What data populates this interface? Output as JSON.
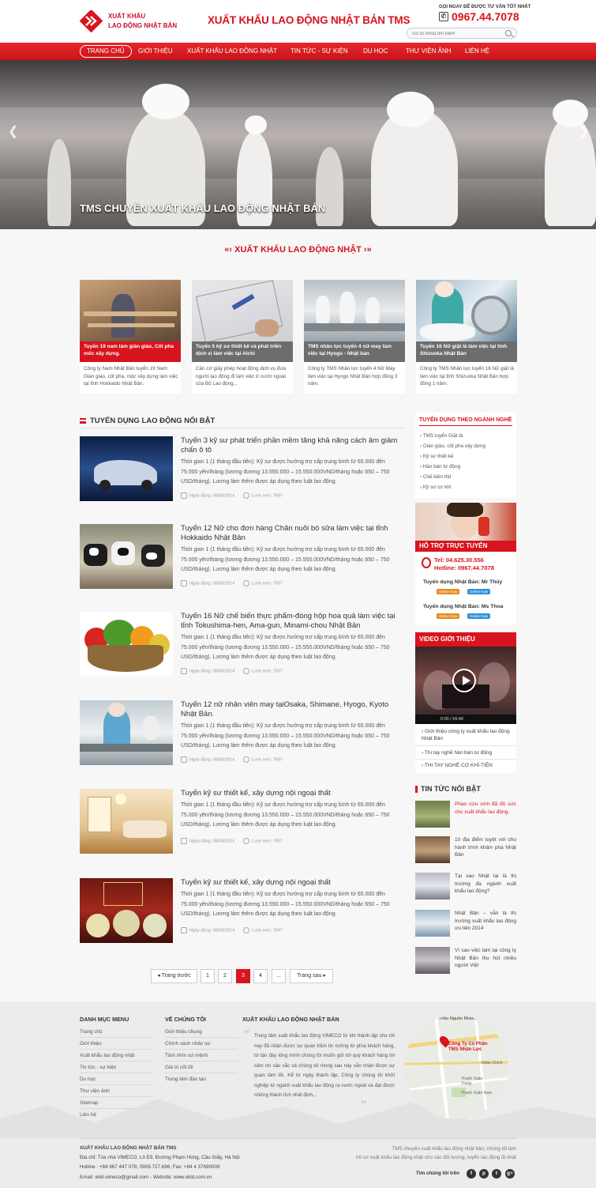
{
  "header": {
    "logo_line1": "XUẤT KHẨU",
    "logo_line2": "LAO ĐỘNG NHẬT BẢN",
    "site_title": "XUẤT KHẨU LAO ĐỘNG NHẬT BẢN TMS",
    "hotline_label": "GỌI NGAY ĐỂ ĐƯỢC TƯ VẤN TỐT NHẤT",
    "hotline_number": "0967.44.7078",
    "search_placeholder": "Gõ từ khóa tìm kiếm"
  },
  "nav": {
    "items": [
      "TRANG CHỦ",
      "GIỚI THIỆU",
      "XUẤT KHẨU LAO ĐỘNG NHẬT",
      "TIN TỨC - SỰ KIỆN",
      "DU HỌC",
      "THƯ VIỆN ẢNH",
      "LIÊN HỆ"
    ]
  },
  "banner": {
    "caption": "TMS CHUYÊN XUẤT KHẨU LAO ĐỘNG NHẬT BẢN",
    "prev": "❮",
    "next": "❯"
  },
  "featured": {
    "title": "XUẤT KHẨU LAO ĐỘNG NHẬT",
    "cards": [
      {
        "caption": "Tuyển 19 nam làm giàn giáo, Cốt pha mốc xây dựng.",
        "desc": "Công ty Nam Nhật Bản tuyển 19 Nam: Giàn giáo, cốt pha, mộc xây dựng làm việc tại tỉnh Hokkaido Nhật Bản."
      },
      {
        "caption": "Tuyển 5 kỹ sư thiết kế và phát triển dịch vị làm việc tại Aichi",
        "desc": "Căn cứ giấy phép hoạt động dịch vụ đưa người lao động đi làm việc ở nước ngoài của Bộ Lao động..."
      },
      {
        "caption": "TMS nhân lực tuyển 4 nữ may làm việc tại Hyogo - Nhật bản",
        "desc": "Công ty TMS Nhân lực tuyển 4 Nữ May làm việc tại Hyogo Nhật Bản hợp đồng 3 năm."
      },
      {
        "caption": "Tuyển 16 Nữ giặt là làm việc tại tỉnh Shizuoka Nhật Bản",
        "desc": "Công ty TMS Nhân lực tuyển 16 Nữ giặt là làm việc tại tỉnh Shizuoka Nhật Bản hợp đồng 1 năm."
      }
    ]
  },
  "jobs": {
    "title": "TUYỂN DỤNG LAO ĐỘNG NỔI BẬT",
    "items": [
      {
        "title": "Tuyển 3 kỹ sư phát triển phần mềm tăng khả năng cách âm giảm chấn ô tô",
        "desc": "Thời gian 1 (1 tháng đầu tiên): Kỹ sư được hưởng trợ cấp trung bình từ 65.000 đến 75.000 yên/tháng (tương đương 13.550.000 – 15.550.000VND/tháng hoặc 650 – 750 USD/tháng). Lương làm thêm được áp dụng theo luật lao động.",
        "date": "Ngày đăng: 08/08/2014",
        "views": "Lượt xem: 7897"
      },
      {
        "title": "Tuyển 12 Nữ cho đơn hàng Chăn nuôi bò sữa làm việc tại tỉnh Hokkaido Nhật Bản",
        "desc": "Thời gian 1 (1 tháng đầu tiên): Kỹ sư được hưởng trợ cấp trung bình từ 65.000 đến 75.000 yên/tháng (tương đương 13.550.000 – 15.550.000VND/tháng hoặc 650 – 750 USD/tháng). Lương làm thêm được áp dụng theo luật lao động.",
        "date": "Ngày đăng: 08/08/2014",
        "views": "Lượt xem: 7897"
      },
      {
        "title": "Tuyển 16 Nữ chế biến thực phẩm-đóng hộp hoa quả làm việc tại tỉnh Tokushima-hen, Ama-gun, Minami-chou Nhật Bản",
        "desc": "Thời gian 1 (1 tháng đầu tiên): Kỹ sư được hưởng trợ cấp trung bình từ 65.000 đến 75.000 yên/tháng (tương đương 13.550.000 – 15.550.000VND/tháng hoặc 650 – 750 USD/tháng). Lương làm thêm được áp dụng theo luật lao động.",
        "date": "Ngày đăng: 08/08/2014",
        "views": "Lượt xem: 7897"
      },
      {
        "title": "Tuyển 12 nữ nhân viên may tạiOsaka, Shimane, Hyogo, Kyoto Nhật Bản.",
        "desc": "Thời gian 1 (1 tháng đầu tiên): Kỹ sư được hưởng trợ cấp trung bình từ 65.000 đến 75.000 yên/tháng (tương đương 13.550.000 – 15.550.000VND/tháng hoặc 650 – 750 USD/tháng). Lương làm thêm được áp dụng theo luật lao động.",
        "date": "Ngày đăng: 08/08/2014",
        "views": "Lượt xem: 7897"
      },
      {
        "title": "Tuyển kỹ sư thiết kế, xây dựng nội ngoại thất",
        "desc": "Thời gian 1 (1 tháng đầu tiên): Kỹ sư được hưởng trợ cấp trung bình từ 65.000 đến 75.000 yên/tháng (tương đương 13.550.000 – 15.550.000VND/tháng hoặc 650 – 750 USD/tháng). Lương làm thêm được áp dụng theo luật lao động.",
        "date": "Ngày đăng: 08/08/2014",
        "views": "Lượt xem: 7897"
      },
      {
        "title": "Tuyển kỹ sư thiết kế, xây dựng nội ngoại thất",
        "desc": "Thời gian 1 (1 tháng đầu tiên): Kỹ sư được hưởng trợ cấp trung bình từ 65.000 đến 75.000 yên/tháng (tương đương 13.550.000 – 15.550.000VND/tháng hoặc 650 – 750 USD/tháng). Lương làm thêm được áp dụng theo luật lao động.",
        "date": "Ngày đăng: 08/08/2014",
        "views": "Lượt xem: 7897"
      }
    ]
  },
  "pagination": {
    "prev": "◂ Trang trước",
    "pages": [
      "1",
      "2",
      "3",
      "4",
      "..."
    ],
    "active": "3",
    "next": "Trang sau ▸"
  },
  "sidebar": {
    "industries_title": "TUYỂN DỤNG THEO NGÀNH NGHỀ",
    "industries": [
      "TMS tuyển Giặt là",
      "Giàn giáo, cốt pha xây dựng",
      "Kỹ sư thiết kế",
      "Hàn bán tự động",
      "Chế biến thịt",
      "Kỹ sư cơ khí"
    ],
    "support_title": "HỖ TRỢ TRỰC TUYẾN",
    "support_tel": "Tel: 04.625.30.556",
    "support_hotline": "Hotline: 0967.44.7078",
    "support_people": [
      "Tuyển dụng Nhật Bản: Mr Thủy",
      "Tuyển dụng Nhật Bản: Ms Thoa"
    ],
    "badge_online": "Online Now",
    "badge_skype": "Online Now",
    "video_title": "VIDEO GIỚI THIỆU",
    "video_time": "0:00 / 56:40",
    "video_links": [
      "Giới thiệu công ty xuất khẩu lao động Nhật Bản",
      "Thi tay nghề hàn bán tự động",
      "THI TAY NGHỀ CƠ KHÍ-TIỆN"
    ],
    "news_title": "TIN TỨC NỔI BẬT",
    "news": [
      "Phao cứu sinh đã đủ sức cho xuất khẩu lao động.",
      "10 địa điểm tuyệt vời cho hành trình khám phá Nhật Bản",
      "Tại sao Nhật lại là thị trường đa ngành xuất khẩu lao động?",
      "Nhật Bản – vẫn là thị trường xuất khẩu lao động ưu tiên 2014",
      "Vì sao việc làm tại công ty Nhật Bản thu hút nhiều người Việt"
    ]
  },
  "footer": {
    "menu_title": "DANH MỤC MENU",
    "menu": [
      "Trang chủ",
      "Giới thiệu",
      "Xuất khẩu lao động nhật",
      "Tin tức - sự kiện",
      "Du học",
      "Thư viện ảnh",
      "Sitemap",
      "Liên hệ"
    ],
    "about_title": "VỀ CHÚNG TÔI",
    "about": [
      "Giới thiệu chung",
      "Chính sách nhân sự",
      "Tầm nhìn sứ mệnh",
      "Giá trị cốt lõi",
      "Trung tâm đào tạo"
    ],
    "xk_title": "XUẤT KHẨU LAO ĐỘNG NHẬT BẢN",
    "xk_text": "Trung tâm xuất khẩu lao động VIMECO từ khi thành lập cho tới nay đã nhận được sự quan trâm tin tưởng từ phía khách hàng, từ tận đáy lòng mình chúng tôi muốn gửi tới quý khách hàng lời cảm ơn sâu sắc và chúng tôi mong sau này vẫn nhận được sự quan tâm đó. Kể từ ngày thành lập, Công ty chúng tôi khởi nghiệp từ ngành xuất khẩu lao động ra nước ngoài và đạt được những thành tích nhất định...",
    "map_label1": "Công Ty Cổ Phần",
    "map_label2": "TMS Nhân Lực",
    "map_top": "Triều Nguồn Nhân...",
    "map_place1": "Nhân Chính",
    "map_place2": "Thanh Xuân Trung",
    "map_place3": "Thanh Xuân Nam",
    "company": "XUẤT KHẨU LAO ĐỘNG NHẬT BẢN TMS",
    "address": "Địa chỉ: Tòa nhà VIMECO, Lô E9, Đường Phạm Hùng, Cầu Giấy, Hà Nội",
    "phones": "Hotline : +84 967 447 078;  0909.727.696;      Fax: +84 4 37690009",
    "email": "Email: xkld.vimeco@gmail.com - Website: www.xkld.com.vn",
    "slogan1": "TMS chuyên xuất khẩu lao động nhật bản, chúng tôi làm",
    "slogan2": "hồ sơ xuất khẩu lao động nhật cho các đối tượng, tuyển lao động đi nhật",
    "follow": "Tìm chúng tôi trên",
    "social": [
      "f",
      "p",
      "t",
      "g+"
    ]
  }
}
